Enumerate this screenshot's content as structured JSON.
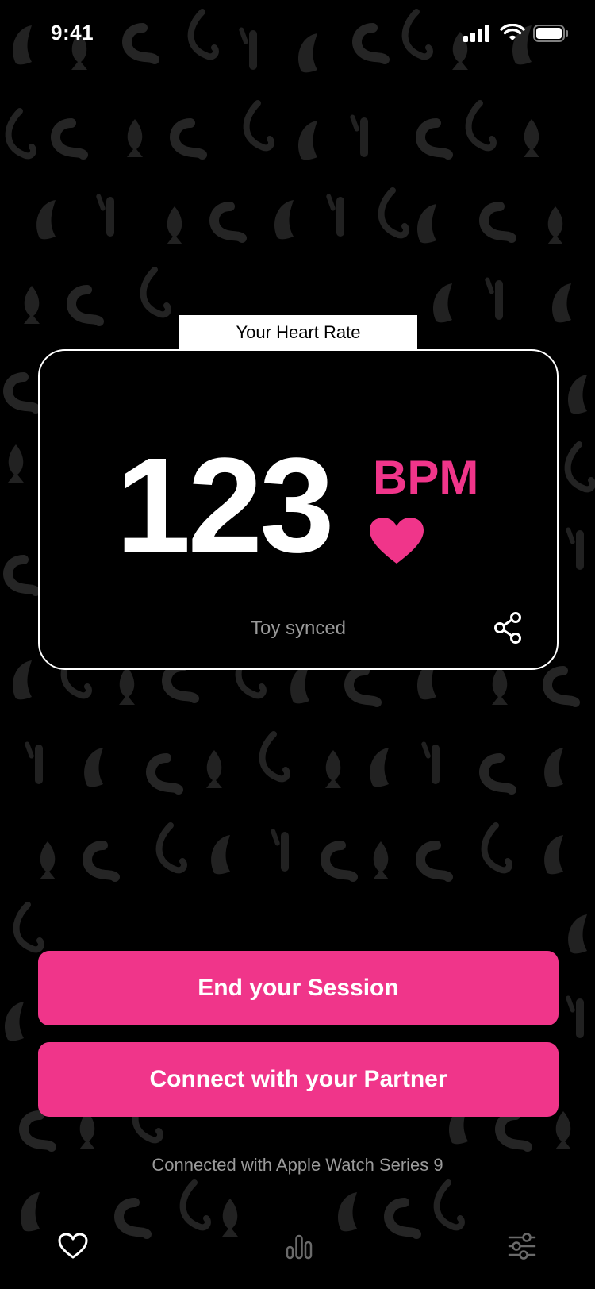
{
  "status_bar": {
    "time": "9:41"
  },
  "heart_rate_card": {
    "tab_label": "Your Heart Rate",
    "value": "123",
    "unit": "BPM",
    "status": "Toy synced",
    "share_icon": "share-icon",
    "heart_icon": "heart-icon"
  },
  "actions": {
    "end_session_label": "End your Session",
    "connect_partner_label": "Connect with your Partner"
  },
  "connection": {
    "text": "Connected with Apple Watch Series 9"
  },
  "tabbar": {
    "items": [
      {
        "icon": "heart-outline-icon"
      },
      {
        "icon": "bar-chart-icon"
      },
      {
        "icon": "sliders-icon"
      }
    ]
  },
  "colors": {
    "accent": "#f0358a",
    "background": "#000000",
    "muted_text": "#9a9a9a"
  }
}
